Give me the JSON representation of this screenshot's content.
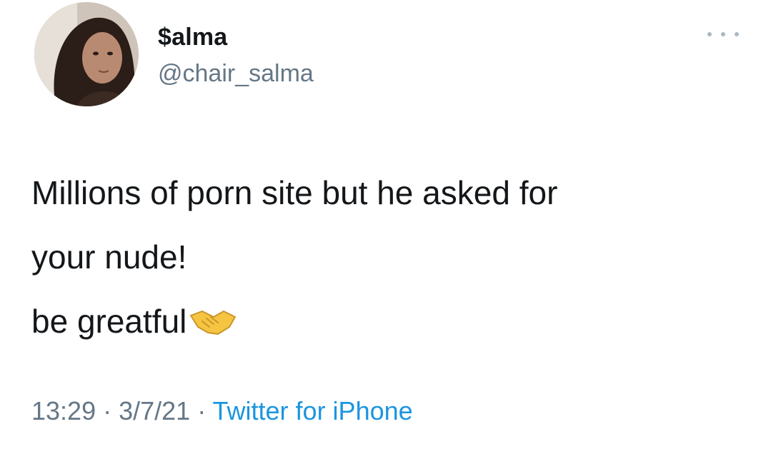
{
  "tweet": {
    "display_name": "$alma",
    "handle": "@chair_salma",
    "text_lines": [
      "Millions of porn site but he asked for",
      "your nude!",
      "be greatful"
    ],
    "emoji": "handshake-icon",
    "time": "13:29",
    "separator": " · ",
    "date": "3/7/21",
    "source": "Twitter for iPhone"
  },
  "colors": {
    "text": "#14171a",
    "secondary": "#657786",
    "link": "#1b95e0"
  }
}
